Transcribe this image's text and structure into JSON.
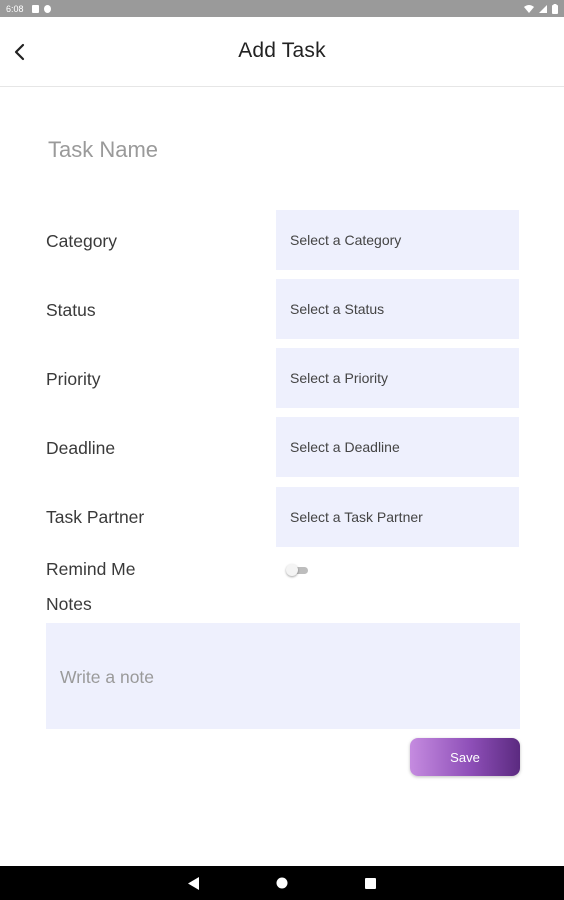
{
  "status_bar": {
    "time": "6:08"
  },
  "header": {
    "title": "Add Task",
    "back_icon": "chevron-left-icon"
  },
  "task_name": {
    "placeholder": "Task Name",
    "value": ""
  },
  "fields": [
    {
      "label": "Category",
      "placeholder": "Select a Category"
    },
    {
      "label": "Status",
      "placeholder": "Select a Status"
    },
    {
      "label": "Priority",
      "placeholder": "Select a Priority"
    },
    {
      "label": "Deadline",
      "placeholder": "Select a Deadline"
    },
    {
      "label": "Task Partner",
      "placeholder": "Select a Task Partner"
    }
  ],
  "remind_me": {
    "label": "Remind Me",
    "enabled": false
  },
  "notes": {
    "label": "Notes",
    "placeholder": "Write a note",
    "value": ""
  },
  "save_button": {
    "label": "Save"
  },
  "colors": {
    "field_background": "#eef0fd",
    "save_gradient_start": "#c58be0",
    "save_gradient_end": "#5b2a80",
    "status_bar": "#9a9a9a",
    "nav_bar": "#000000"
  },
  "nav_bar": {
    "back_icon": "triangle-back-icon",
    "home_icon": "circle-home-icon",
    "recents_icon": "square-recents-icon"
  }
}
